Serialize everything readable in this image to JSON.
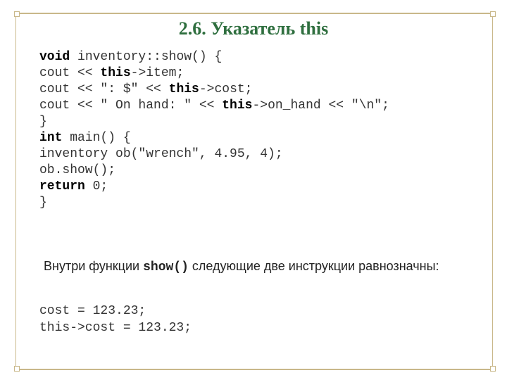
{
  "title": "2.6. Указатель this",
  "code": {
    "l1a": "void",
    "l1b": " inventory::show() {",
    "l2a": "cout << ",
    "l2b": "this",
    "l2c": "->item;",
    "l3a": "cout << \": $\" << ",
    "l3b": "this",
    "l3c": "->cost;",
    "l4a": "cout << \" On hand: \" << ",
    "l4b": "this",
    "l4c": "->on_hand << \"\\n\";",
    "l5": "}",
    "l6a": "int",
    "l6b": " main() {",
    "l7": "inventory ob(\"wrench\", 4.95, 4);",
    "l8": "ob.show();",
    "l9a": "return",
    "l9b": " 0;",
    "l10": "}"
  },
  "para": {
    "a": "Внутри функции ",
    "fn": "show()",
    "b": " следующие две инструкции равнозначны:"
  },
  "code2": {
    "l1": "cost = 123.23;",
    "l2": "this->cost = 123.23;"
  }
}
